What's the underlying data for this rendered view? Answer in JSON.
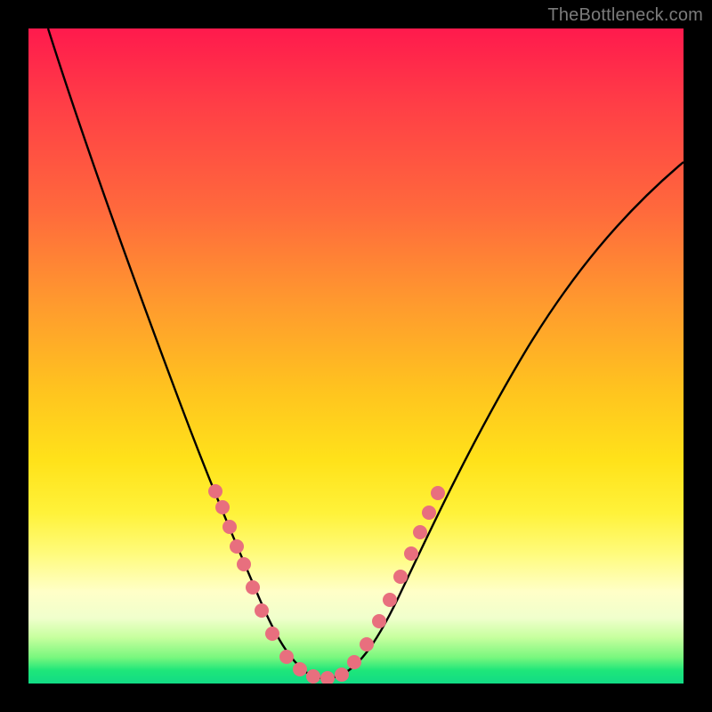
{
  "watermark": {
    "text": "TheBottleneck.com"
  },
  "chart_data": {
    "type": "line",
    "title": "",
    "xlabel": "",
    "ylabel": "",
    "xlim": [
      0,
      100
    ],
    "ylim": [
      0,
      100
    ],
    "series": [
      {
        "name": "bottleneck-curve",
        "x": [
          3,
          6,
          10,
          14,
          18,
          22,
          25,
          28,
          30,
          32,
          34,
          36,
          38,
          40,
          42,
          44,
          46,
          48,
          52,
          56,
          60,
          66,
          74,
          82,
          90,
          98
        ],
        "y": [
          100,
          88,
          74,
          61,
          49,
          38,
          30,
          22,
          16,
          11,
          7,
          4,
          2,
          1,
          1,
          2,
          4,
          7,
          13,
          20,
          27,
          36,
          47,
          57,
          65,
          72
        ]
      }
    ],
    "markers": {
      "name": "highlighted-points",
      "color": "#e86f7e",
      "x": [
        26,
        27,
        28,
        29.5,
        30.5,
        32,
        33,
        35,
        37,
        39,
        41,
        43,
        45,
        47,
        48.5,
        50,
        51.5,
        53,
        55,
        57
      ],
      "y": [
        28,
        26,
        23,
        19,
        17,
        12,
        10,
        6,
        3,
        1.5,
        1.5,
        2.5,
        4,
        6.5,
        9,
        12,
        15,
        18,
        23,
        27
      ]
    },
    "background_gradient": {
      "direction": "vertical",
      "stops": [
        {
          "pos": 0.0,
          "color": "#ff1a4d"
        },
        {
          "pos": 0.28,
          "color": "#ff6a3c"
        },
        {
          "pos": 0.55,
          "color": "#ffc31f"
        },
        {
          "pos": 0.8,
          "color": "#fffb7a"
        },
        {
          "pos": 0.93,
          "color": "#c6ff9e"
        },
        {
          "pos": 1.0,
          "color": "#12db85"
        }
      ]
    }
  }
}
